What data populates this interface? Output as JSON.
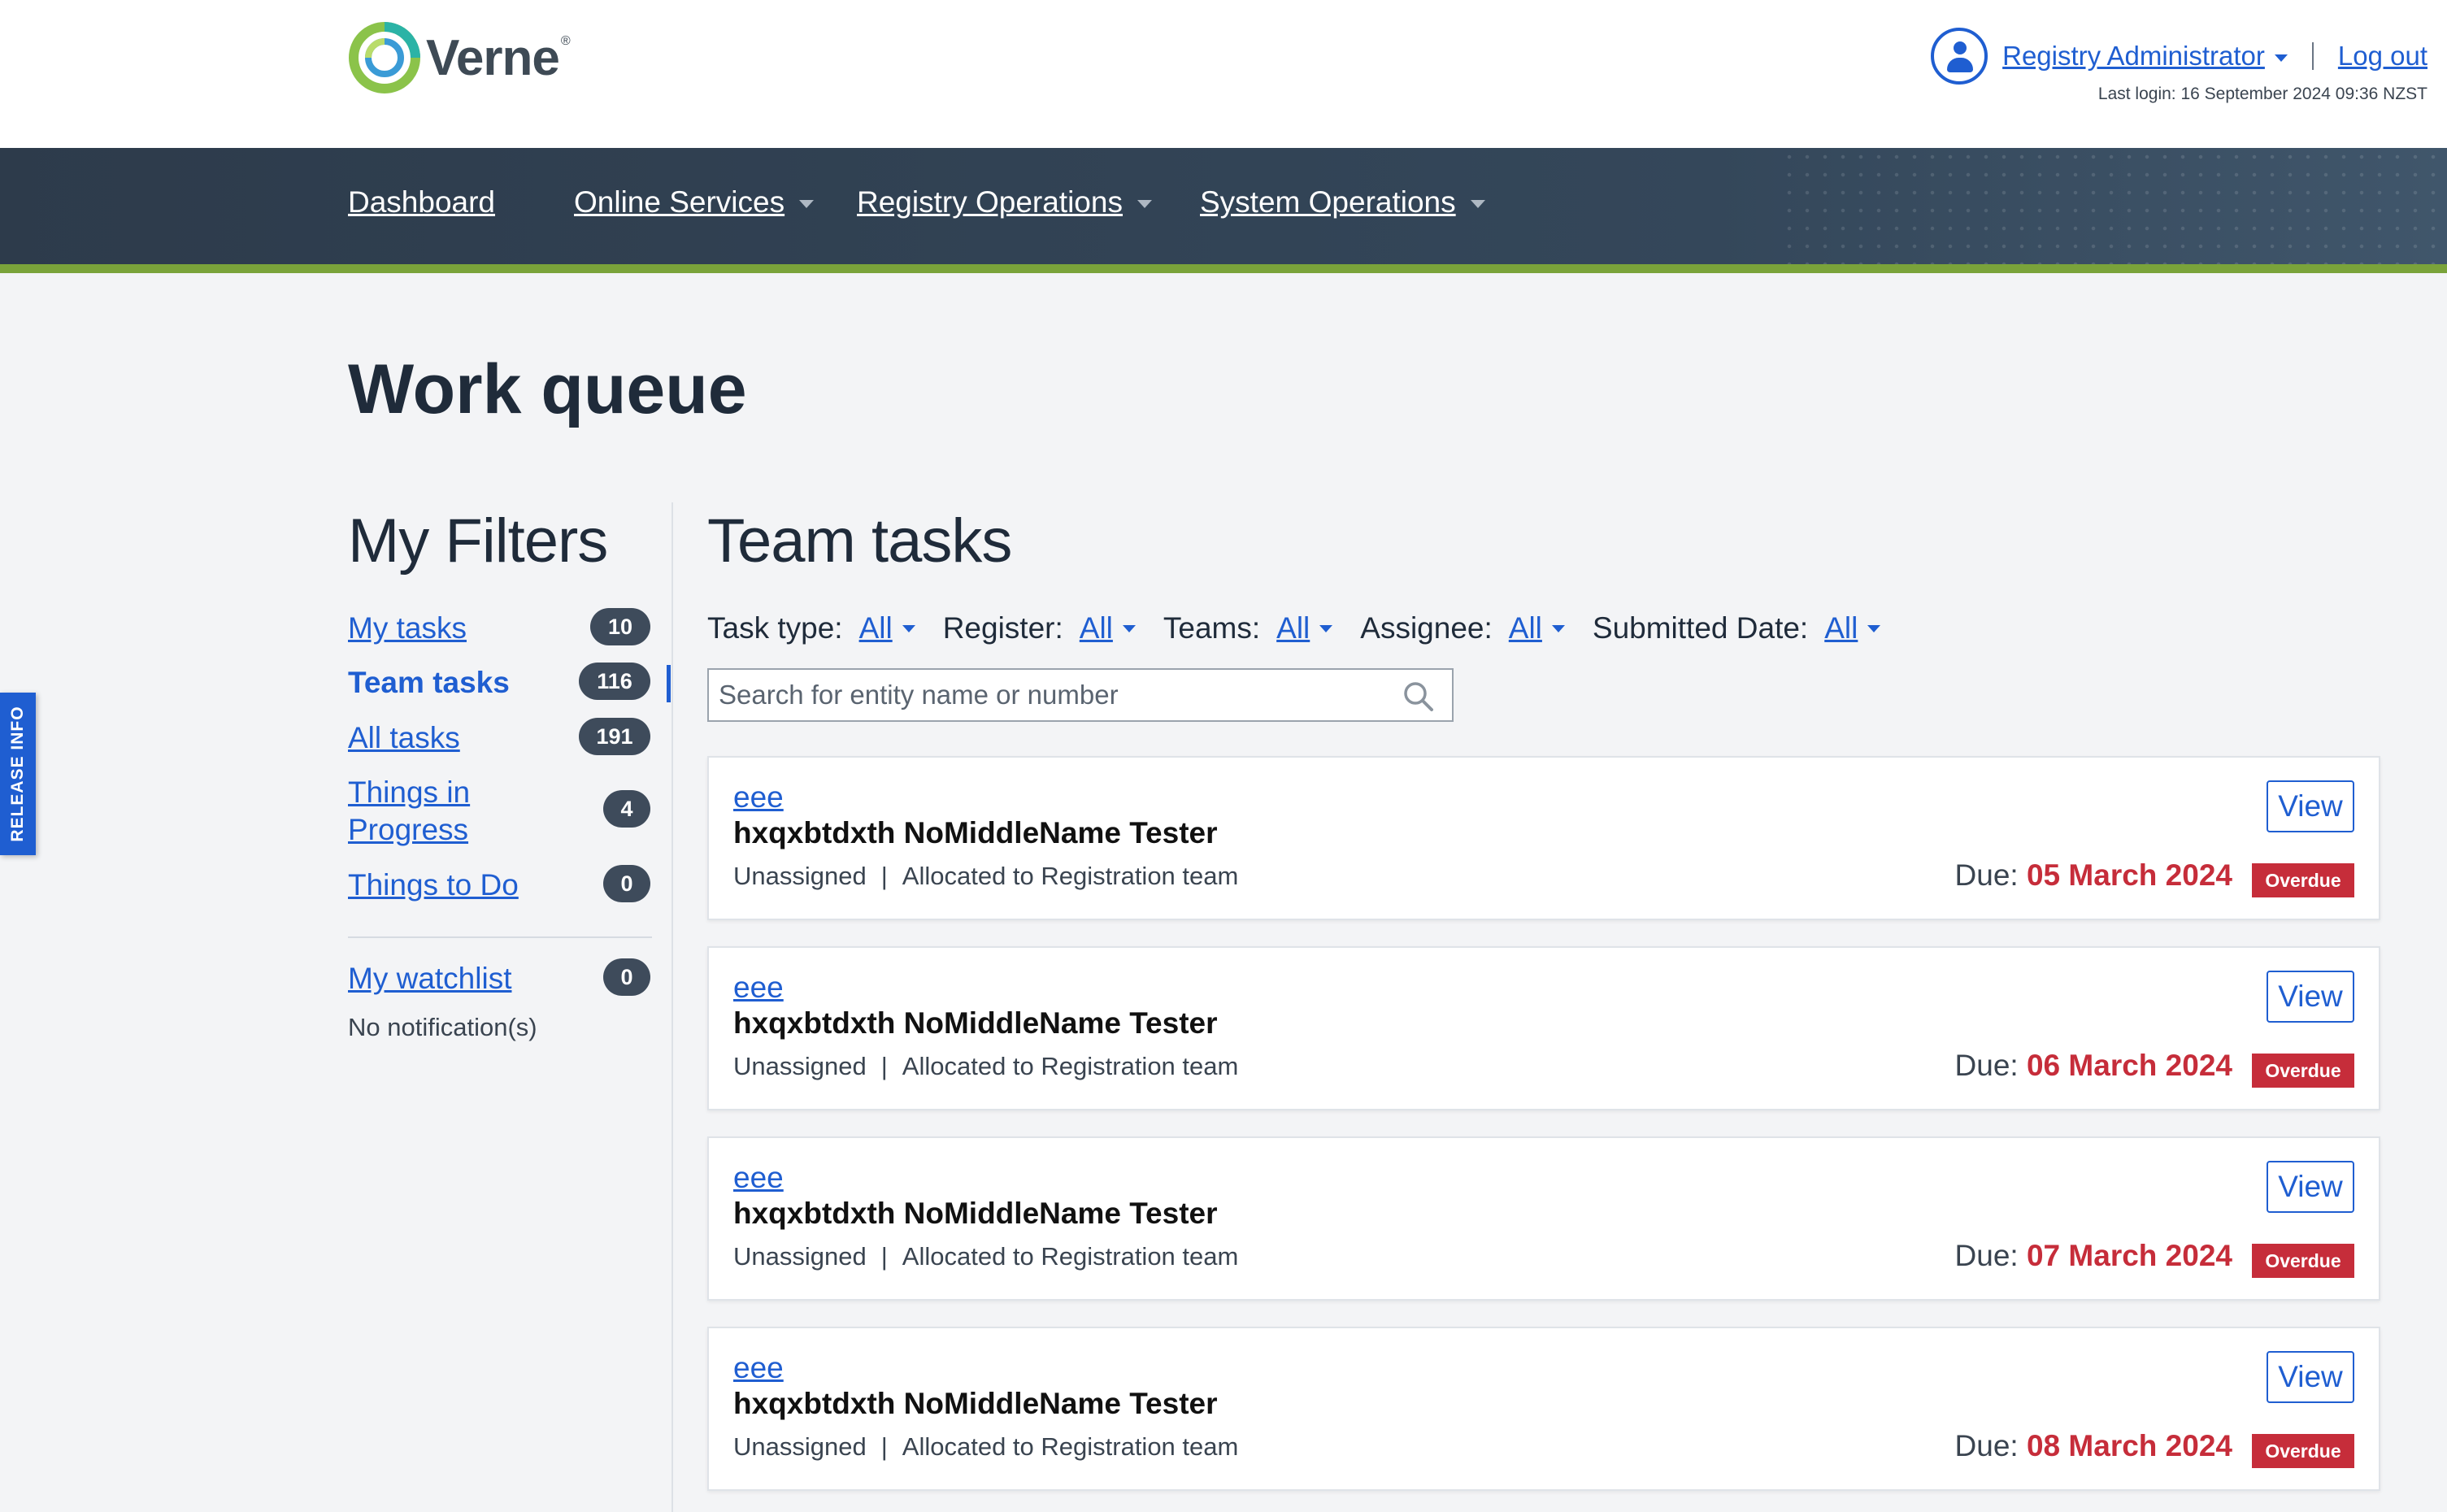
{
  "header": {
    "logo_text": "Verne",
    "logo_registered": "®",
    "user_name": "Registry Administrator",
    "logout_label": "Log out",
    "last_login": "Last login: 16 September 2024 09:36 NZST"
  },
  "nav": {
    "items": [
      {
        "label": "Dashboard"
      },
      {
        "label": "Online Services"
      },
      {
        "label": "Registry Operations"
      },
      {
        "label": "System Operations"
      }
    ]
  },
  "page": {
    "title": "Work queue"
  },
  "sidebar": {
    "title": "My Filters",
    "items": [
      {
        "label": "My tasks",
        "count": "10"
      },
      {
        "label": "Team tasks",
        "count": "116"
      },
      {
        "label": "All tasks",
        "count": "191"
      },
      {
        "label": "Things in Progress",
        "count": "4"
      },
      {
        "label": "Things to Do",
        "count": "0"
      }
    ],
    "watchlist": {
      "label": "My watchlist",
      "count": "0"
    },
    "notifications": "No notification(s)"
  },
  "main": {
    "title": "Team tasks",
    "filters": [
      {
        "label": "Task type:",
        "value": "All"
      },
      {
        "label": "Register:",
        "value": "All"
      },
      {
        "label": "Teams:",
        "value": "All"
      },
      {
        "label": "Assignee:",
        "value": "All"
      },
      {
        "label": "Submitted Date:",
        "value": "All"
      }
    ],
    "search": {
      "placeholder": "Search for entity name or number"
    },
    "tasks": [
      {
        "ref": "eee",
        "name": "hxqxbtdxth NoMiddleName Tester",
        "assignee": "Unassigned",
        "separator": "|",
        "allocation": "Allocated to Registration team",
        "due_label": "Due:",
        "due_date": "05 March 2024",
        "status": "Overdue",
        "view_label": "View"
      },
      {
        "ref": "eee",
        "name": "hxqxbtdxth NoMiddleName Tester",
        "assignee": "Unassigned",
        "separator": "|",
        "allocation": "Allocated to Registration team",
        "due_label": "Due:",
        "due_date": "06 March 2024",
        "status": "Overdue",
        "view_label": "View"
      },
      {
        "ref": "eee",
        "name": "hxqxbtdxth NoMiddleName Tester",
        "assignee": "Unassigned",
        "separator": "|",
        "allocation": "Allocated to Registration team",
        "due_label": "Due:",
        "due_date": "07 March 2024",
        "status": "Overdue",
        "view_label": "View"
      },
      {
        "ref": "eee",
        "name": "hxqxbtdxth NoMiddleName Tester",
        "assignee": "Unassigned",
        "separator": "|",
        "allocation": "Allocated to Registration team",
        "due_label": "Due:",
        "due_date": "08 March 2024",
        "status": "Overdue",
        "view_label": "View"
      }
    ]
  },
  "release_tab": {
    "label": "RELEASE INFO"
  },
  "colors": {
    "accent_blue": "#1f5ed1",
    "nav_bg": "#2d3b4b",
    "nav_accent_green": "#7aa33a",
    "overdue_red": "#c62d3a",
    "badge_bg": "#3e4b5b"
  }
}
